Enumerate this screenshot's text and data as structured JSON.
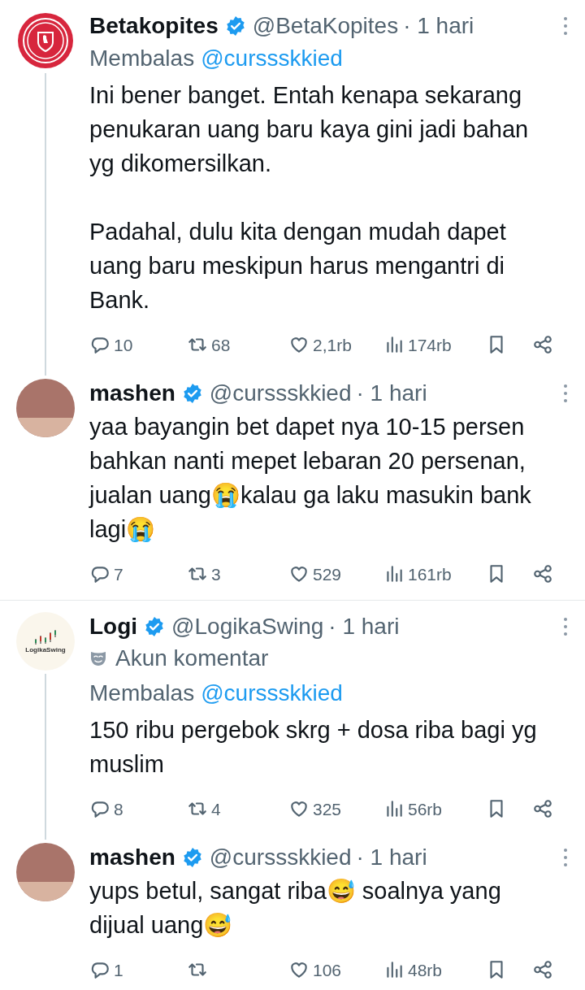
{
  "threads": [
    {
      "tweets": [
        {
          "avatar": {
            "kind": "crest"
          },
          "name": "Betakopites",
          "verified": true,
          "handle": "@BetaKopites",
          "time": "· 1 hari",
          "reply_to": {
            "prefix": "Membalas",
            "handle": "@curssskkied"
          },
          "paragraphs": [
            "Ini bener banget. Entah kenapa sekarang penukaran uang baru kaya gini jadi bahan yg dikomersilkan.",
            "Padahal, dulu kita dengan mudah dapet uang baru meskipun harus mengantri di Bank."
          ],
          "stats": {
            "replies": "10",
            "reposts": "68",
            "likes": "2,1rb",
            "views": "174rb"
          }
        },
        {
          "avatar": {
            "kind": "photo"
          },
          "name": "mashen",
          "verified": true,
          "handle": "@curssskkied",
          "time": "· 1 hari",
          "paragraphs": [
            "yaa bayangin bet dapet nya 10-15 persen bahkan nanti mepet lebaran 20 persenan, jualan uang😭kalau ga laku masukin bank lagi😭"
          ],
          "stats": {
            "replies": "7",
            "reposts": "3",
            "likes": "529",
            "views": "161rb"
          }
        }
      ]
    },
    {
      "tweets": [
        {
          "avatar": {
            "kind": "chart_logo",
            "label": "LogikaSwing"
          },
          "name": "Logi",
          "verified": true,
          "handle": "@LogikaSwing",
          "time": "· 1 hari",
          "badge": "Akun komentar",
          "reply_to": {
            "prefix": "Membalas",
            "handle": "@curssskkied"
          },
          "paragraphs": [
            "150 ribu pergebok skrg + dosa riba bagi yg muslim"
          ],
          "stats": {
            "replies": "8",
            "reposts": "4",
            "likes": "325",
            "views": "56rb"
          }
        },
        {
          "avatar": {
            "kind": "photo"
          },
          "name": "mashen",
          "verified": true,
          "handle": "@curssskkied",
          "time": "· 1 hari",
          "paragraphs": [
            "yups betul, sangat riba😅 soalnya yang dijual uang😅"
          ],
          "stats": {
            "replies": "1",
            "likes": "106",
            "views": "48rb"
          }
        }
      ]
    }
  ]
}
